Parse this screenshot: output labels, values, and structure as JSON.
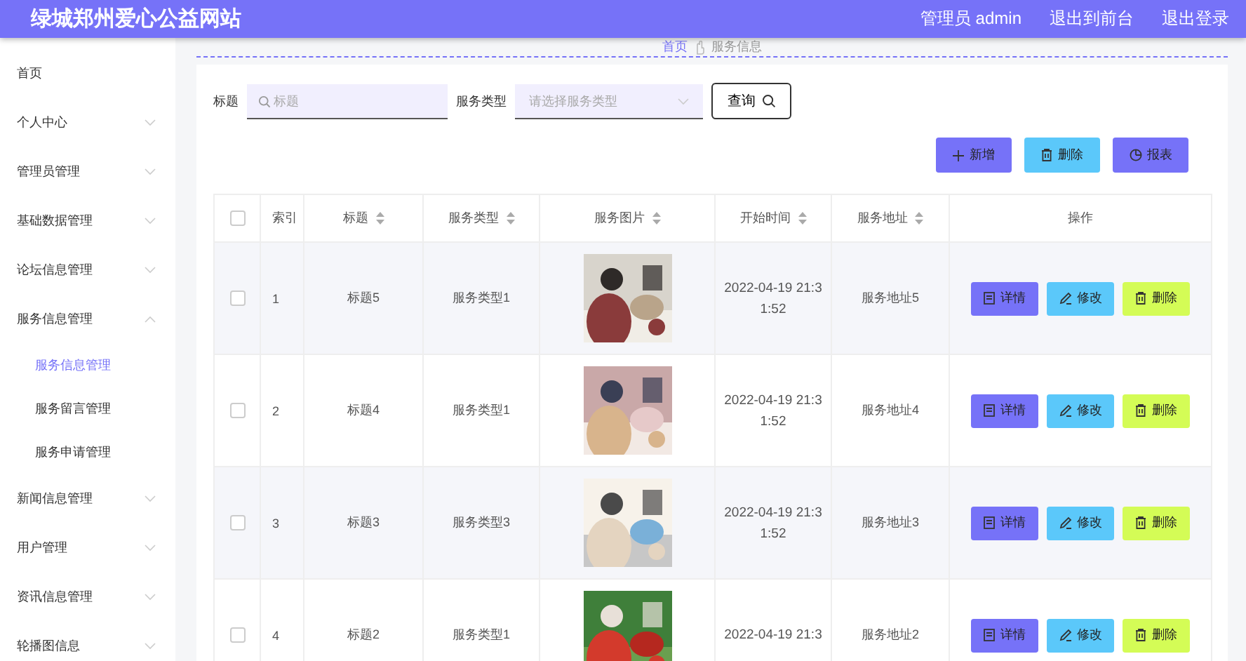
{
  "header": {
    "site_title": "绿城郑州爱心公益网站",
    "user": "管理员 admin",
    "links": [
      "退出到前台",
      "退出登录"
    ]
  },
  "sidebar": {
    "items": [
      {
        "label": "首页",
        "selected": false
      },
      {
        "label": "个人中心",
        "expanded": false,
        "selected": false
      },
      {
        "label": "管理员管理",
        "expanded": false,
        "selected": false
      },
      {
        "label": "基础数据管理",
        "expanded": false,
        "selected": false
      },
      {
        "label": "论坛信息管理",
        "expanded": false,
        "selected": false
      },
      {
        "label": "服务信息管理",
        "expanded": true,
        "selected": false,
        "children": [
          {
            "label": "服务信息管理",
            "selected": true
          },
          {
            "label": "服务留言管理",
            "selected": false
          },
          {
            "label": "服务申请管理",
            "selected": false
          }
        ]
      },
      {
        "label": "新闻信息管理",
        "expanded": false,
        "selected": false
      },
      {
        "label": "用户管理",
        "expanded": false,
        "selected": false
      },
      {
        "label": "资讯信息管理",
        "expanded": false,
        "selected": false
      },
      {
        "label": "轮播图信息",
        "expanded": false,
        "selected": false
      }
    ]
  },
  "breadcrumb": [
    "首页",
    "服务信息"
  ],
  "search": {
    "fields": [
      {
        "label": "标题",
        "kind": "text",
        "placeholder": "标题"
      },
      {
        "label": "服务类型",
        "kind": "select",
        "placeholder": "请选择服务类型"
      }
    ],
    "button": "查询"
  },
  "actions": [
    {
      "kind": "add",
      "label": "新增"
    },
    {
      "kind": "delete",
      "label": "删除"
    },
    {
      "kind": "report",
      "label": "报表"
    }
  ],
  "table": {
    "select_all": false,
    "columns": [
      {
        "label": "索引",
        "sortable": false
      },
      {
        "label": "标题",
        "sortable": true
      },
      {
        "label": "服务类型",
        "sortable": true
      },
      {
        "label": "服务图片",
        "sortable": true
      },
      {
        "label": "开始时间",
        "sortable": true
      },
      {
        "label": "服务地址",
        "sortable": true
      },
      {
        "label": "操作",
        "sortable": false
      }
    ],
    "rows": [
      {
        "checked": false,
        "index": "1",
        "title": "标题5",
        "type": "服务类型1",
        "picture": {
          "kind": "picture"
        },
        "time": "2022-04-19 21:31:52",
        "address": "服务地址5",
        "buttons": [
          {
            "kind": "detail",
            "label": "详情"
          },
          {
            "kind": "edit",
            "label": "修改"
          },
          {
            "kind": "delete",
            "label": "删除"
          }
        ]
      },
      {
        "checked": false,
        "index": "2",
        "title": "标题4",
        "type": "服务类型1",
        "picture": {
          "kind": "picture"
        },
        "time": "2022-04-19 21:31:52",
        "address": "服务地址4",
        "buttons": [
          {
            "kind": "detail",
            "label": "详情"
          },
          {
            "kind": "edit",
            "label": "修改"
          },
          {
            "kind": "delete",
            "label": "删除"
          }
        ]
      },
      {
        "checked": false,
        "index": "3",
        "title": "标题3",
        "type": "服务类型3",
        "picture": {
          "kind": "picture"
        },
        "time": "2022-04-19 21:31:52",
        "address": "服务地址3",
        "buttons": [
          {
            "kind": "detail",
            "label": "详情"
          },
          {
            "kind": "edit",
            "label": "修改"
          },
          {
            "kind": "delete",
            "label": "删除"
          }
        ]
      },
      {
        "checked": false,
        "index": "4",
        "title": "标题2",
        "type": "服务类型1",
        "picture": {
          "kind": "picture"
        },
        "time": "2022-04-19 21:3",
        "address": "服务地址2",
        "buttons": [
          {
            "kind": "detail",
            "label": "详情"
          },
          {
            "kind": "edit",
            "label": "修改"
          },
          {
            "kind": "delete",
            "label": "删除"
          }
        ]
      }
    ]
  }
}
